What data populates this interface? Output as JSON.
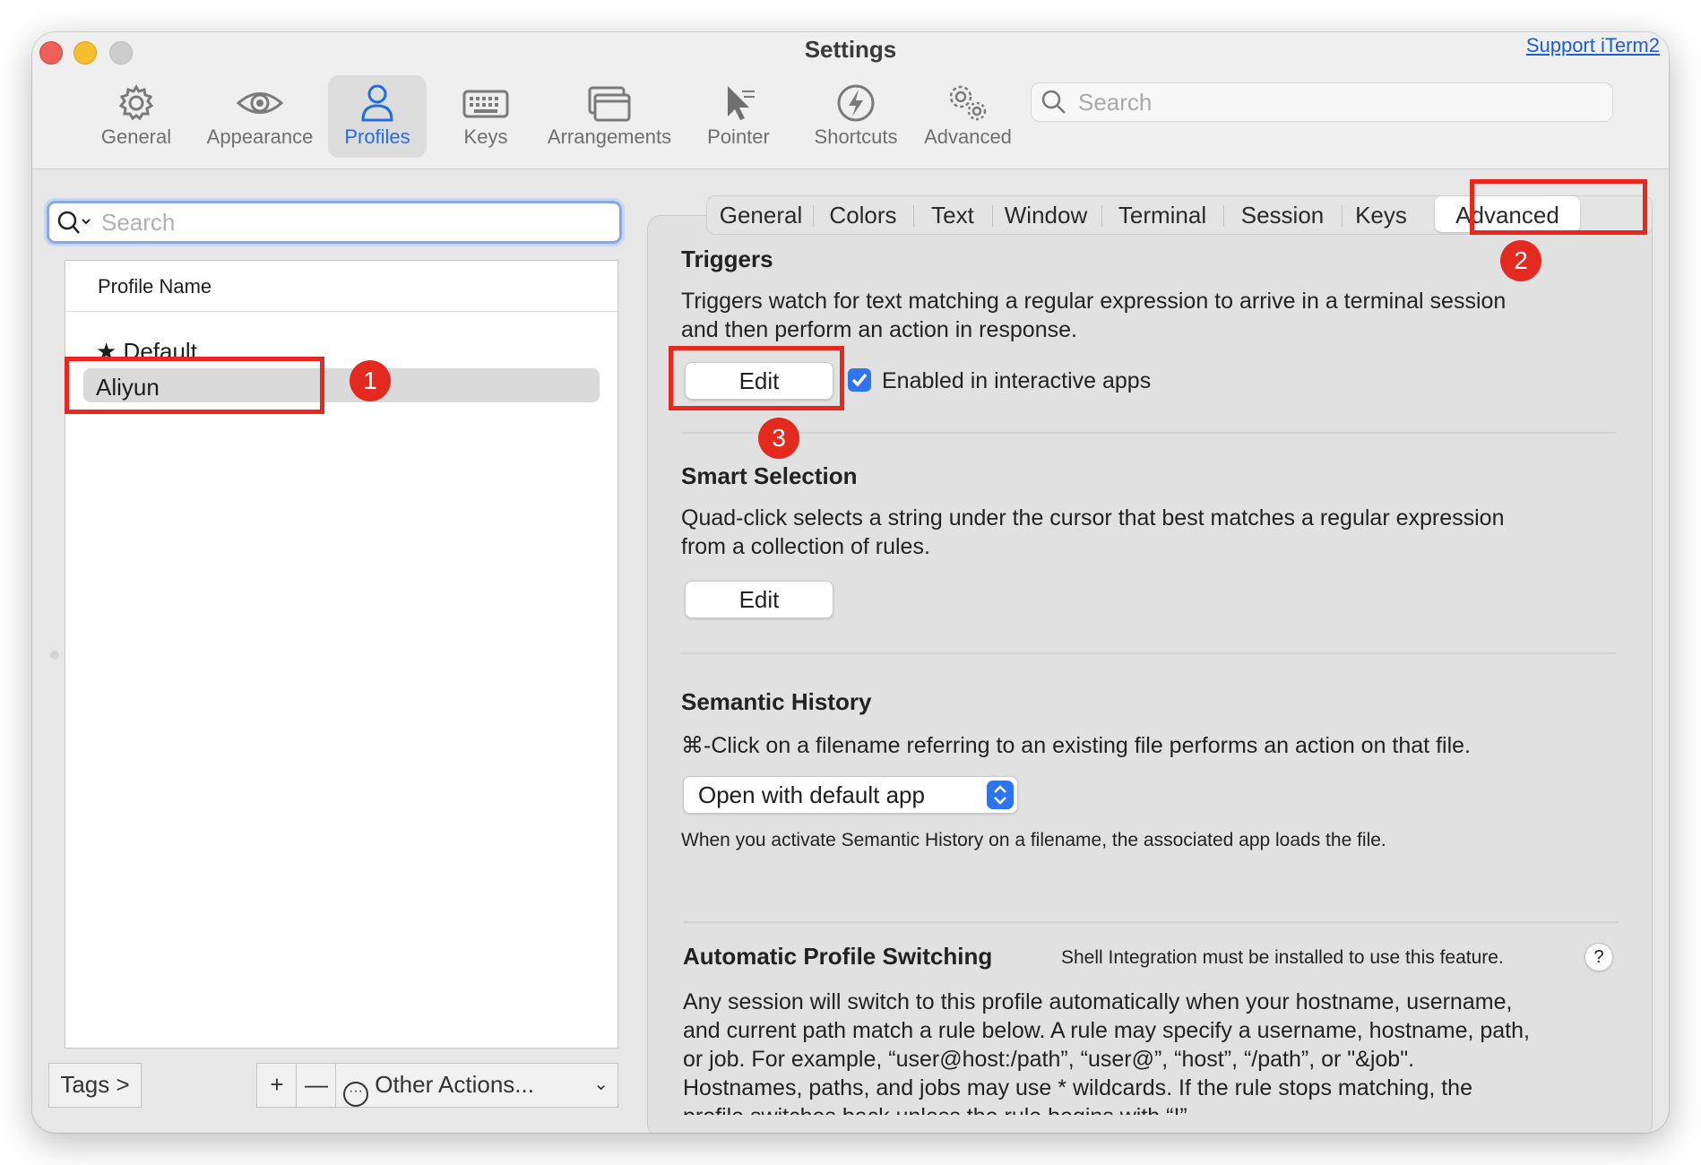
{
  "window": {
    "title": "Settings",
    "support_link": "Support iTerm2"
  },
  "toolbar": {
    "items": [
      {
        "label": "General",
        "icon": "gear-icon"
      },
      {
        "label": "Appearance",
        "icon": "eye-icon"
      },
      {
        "label": "Profiles",
        "icon": "person-icon",
        "active": true
      },
      {
        "label": "Keys",
        "icon": "keyboard-icon"
      },
      {
        "label": "Arrangements",
        "icon": "window-stack-icon"
      },
      {
        "label": "Pointer",
        "icon": "cursor-icon"
      },
      {
        "label": "Shortcuts",
        "icon": "lightning-icon"
      },
      {
        "label": "Advanced",
        "icon": "gears-icon"
      }
    ],
    "search_placeholder": "Search"
  },
  "profiles": {
    "search_placeholder": "Search",
    "column_header": "Profile Name",
    "items": [
      {
        "name": "Default",
        "is_default": true,
        "selected": false
      },
      {
        "name": "Aliyun",
        "is_default": false,
        "selected": true
      }
    ],
    "tags_button": "Tags >",
    "add_button": "+",
    "remove_button": "—",
    "other_actions": "Other Actions..."
  },
  "tabs": [
    {
      "label": "General"
    },
    {
      "label": "Colors"
    },
    {
      "label": "Text"
    },
    {
      "label": "Window"
    },
    {
      "label": "Terminal"
    },
    {
      "label": "Session"
    },
    {
      "label": "Keys"
    },
    {
      "label": "Advanced",
      "active": true
    }
  ],
  "triggers": {
    "title": "Triggers",
    "description_line1": "Triggers watch for text matching a regular expression to arrive in a terminal session",
    "description_line2": "and then perform an action in response.",
    "edit_button": "Edit",
    "checkbox_label": "Enabled in interactive apps",
    "checkbox_checked": true
  },
  "smart_selection": {
    "title": "Smart Selection",
    "description_line1": "Quad-click selects a string under the cursor that best matches a regular expression",
    "description_line2": "from a collection of rules.",
    "edit_button": "Edit"
  },
  "semantic_history": {
    "title": "Semantic History",
    "description": "⌘-Click on a filename referring to an existing file performs an action on that file.",
    "selected_option": "Open with default app",
    "note": "When you activate Semantic History on a filename, the associated app loads the file."
  },
  "auto_profile_switching": {
    "title": "Automatic Profile Switching",
    "note": "Shell Integration must be installed to use this feature.",
    "help": "?",
    "lines": [
      "Any session will switch to this profile automatically when your hostname, username,",
      "and current path match a rule below. A rule may specify a username, hostname, path,",
      "or job. For example, “user@host:/path”, “user@”, “host”, “/path”, or \"&job\".",
      "Hostnames, paths, and jobs may use * wildcards. If the rule stops matching, the",
      "profile switches back unless the rule begins with “!”."
    ]
  },
  "annotations": {
    "marker1": "1",
    "marker2": "2",
    "marker3": "3",
    "color": "#e8281f"
  },
  "colors": {
    "accent": "#2c74f0",
    "active_toolbar_text": "#1f6ee8"
  }
}
